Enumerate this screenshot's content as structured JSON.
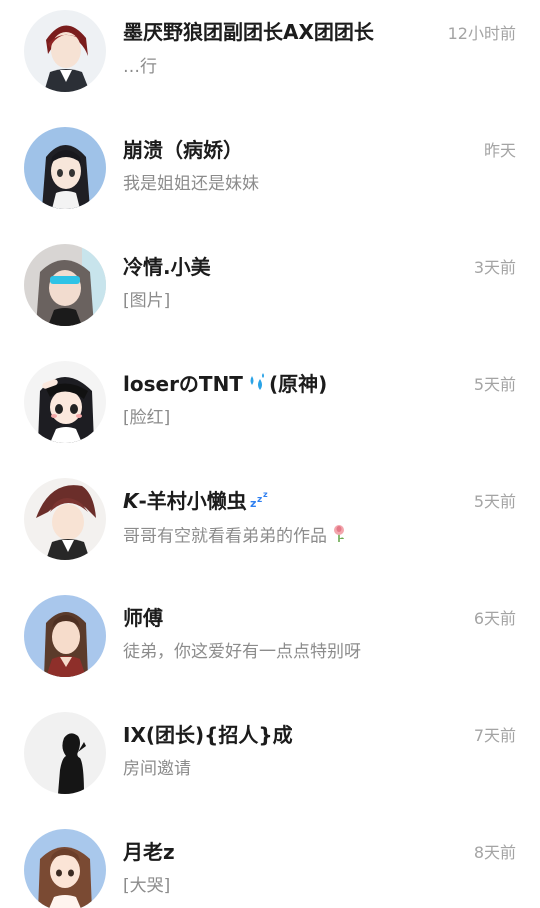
{
  "conversations": [
    {
      "name": "墨厌野狼团副团长AX团团长",
      "preview": "…行",
      "time": "12小时前"
    },
    {
      "name": "崩溃（病娇）",
      "preview": "我是姐姐还是妹妹",
      "time": "昨天"
    },
    {
      "name": "冷情.小美",
      "preview": "[图片]",
      "time": "3天前"
    },
    {
      "name": "loserのTNT",
      "name_suffix": "(原神)",
      "preview": "[脸红]",
      "time": "5天前"
    },
    {
      "name_prefix": "K",
      "name": "-羊村小懒虫",
      "preview": "哥哥有空就看看弟弟的作品",
      "time": "5天前"
    },
    {
      "name": "师傅",
      "preview": "徒弟，你这爱好有一点点特别呀",
      "time": "6天前"
    },
    {
      "name": "IX(团长){招人}成",
      "preview": "房间邀请",
      "time": "7天前"
    },
    {
      "name": "月老z",
      "preview": "[大哭]",
      "time": "8天前"
    }
  ],
  "icons": {
    "sweat": "sweat-droplets-icon",
    "sleep": "zzz-icon",
    "flower": "wilted-flower-icon"
  },
  "colors": {
    "name": "#1c1c1c",
    "preview": "#8c8c8c",
    "time": "#a4a4a4"
  }
}
